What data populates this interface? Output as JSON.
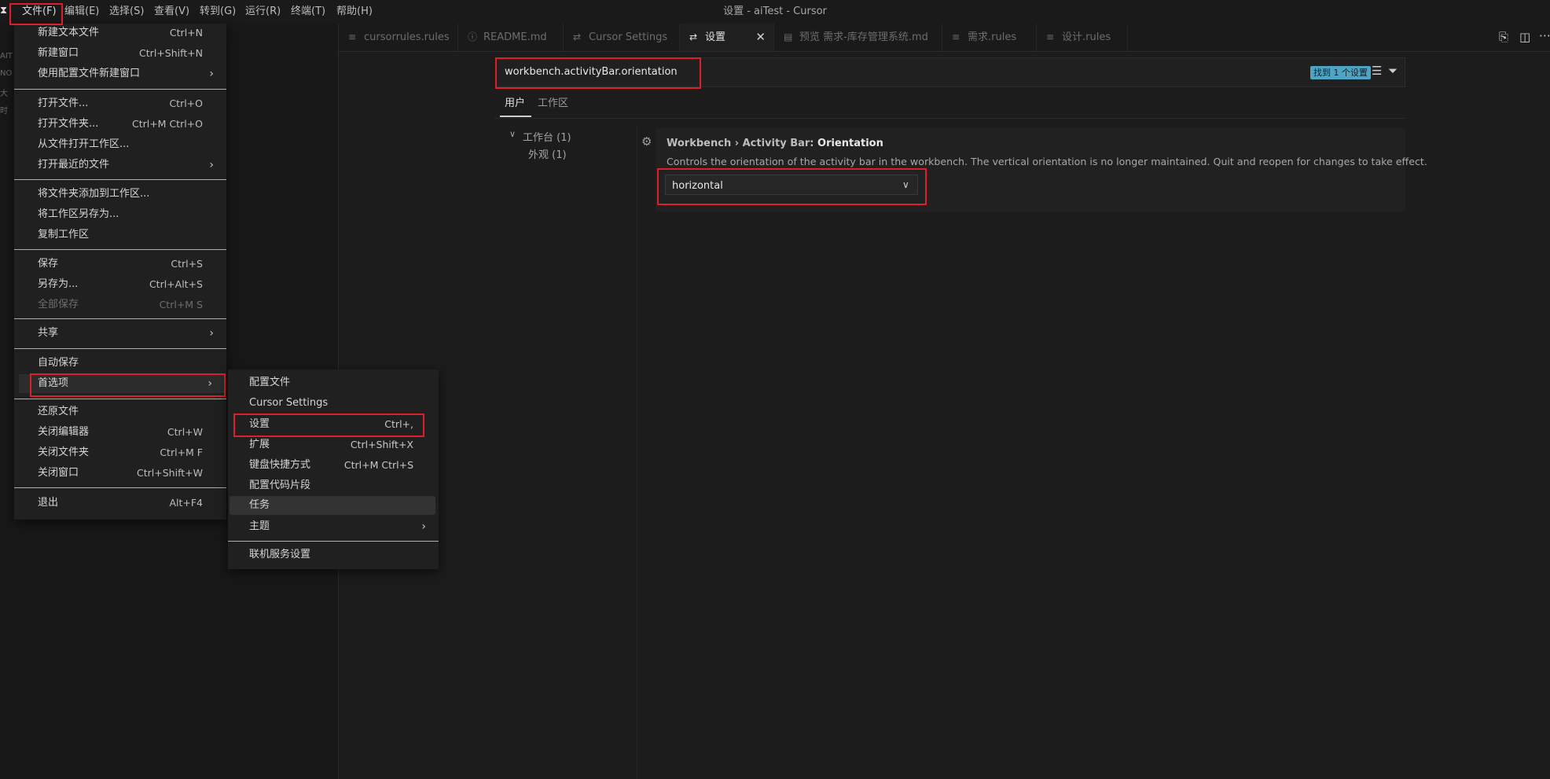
{
  "window": {
    "title": "设置 - aiTest - Cursor"
  },
  "menubar": [
    "文件(F)",
    "编辑(E)",
    "选择(S)",
    "查看(V)",
    "转到(G)",
    "运行(R)",
    "终端(T)",
    "帮助(H)"
  ],
  "explorer_bits": [
    "AIT",
    "NO",
    "大",
    "时"
  ],
  "tabs": [
    {
      "label": "cursorrules.rules",
      "icon": "≡"
    },
    {
      "label": "README.md",
      "icon": "ⓘ"
    },
    {
      "label": "Cursor Settings",
      "icon": "⇄"
    },
    {
      "label": "设置",
      "icon": "⇄"
    },
    {
      "label": "预览 需求-库存管理系统.md",
      "icon": "▤"
    },
    {
      "label": "需求.rules",
      "icon": "≡"
    },
    {
      "label": "设计.rules",
      "icon": "≡"
    }
  ],
  "settings": {
    "search_value": "workbench.activityBar.orientation",
    "found_badge": "找到 1 个设置",
    "tab_user": "用户",
    "tab_workspace": "工作区",
    "toc_workbench": "工作台 (1)",
    "toc_appearance": "外观 (1)",
    "setting_title_prefix": "Workbench › Activity Bar: ",
    "setting_title_key": "Orientation",
    "setting_desc": "Controls the orientation of the activity bar in the workbench. The vertical orientation is no longer maintained. Quit and reopen for changes to take effect.",
    "dropdown_value": "horizontal"
  },
  "file_menu": {
    "items": [
      {
        "label": "新建文本文件",
        "shortcut": "Ctrl+N"
      },
      {
        "label": "新建窗口",
        "shortcut": "Ctrl+Shift+N"
      },
      {
        "label": "使用配置文件新建窗口",
        "shortcut": ""
      },
      {
        "label": "打开文件...",
        "shortcut": "Ctrl+O"
      },
      {
        "label": "打开文件夹...",
        "shortcut": "Ctrl+M Ctrl+O"
      },
      {
        "label": "从文件打开工作区...",
        "shortcut": ""
      },
      {
        "label": "打开最近的文件",
        "shortcut": ""
      },
      {
        "label": "将文件夹添加到工作区...",
        "shortcut": ""
      },
      {
        "label": "将工作区另存为...",
        "shortcut": ""
      },
      {
        "label": "复制工作区",
        "shortcut": ""
      },
      {
        "label": "保存",
        "shortcut": "Ctrl+S"
      },
      {
        "label": "另存为...",
        "shortcut": "Ctrl+Alt+S"
      },
      {
        "label": "全部保存",
        "shortcut": "Ctrl+M S"
      },
      {
        "label": "共享",
        "shortcut": ""
      },
      {
        "label": "自动保存",
        "shortcut": ""
      },
      {
        "label": "首选项",
        "shortcut": ""
      },
      {
        "label": "还原文件",
        "shortcut": ""
      },
      {
        "label": "关闭编辑器",
        "shortcut": "Ctrl+W"
      },
      {
        "label": "关闭文件夹",
        "shortcut": "Ctrl+M F"
      },
      {
        "label": "关闭窗口",
        "shortcut": "Ctrl+Shift+W"
      },
      {
        "label": "退出",
        "shortcut": "Alt+F4"
      }
    ]
  },
  "pref_menu": {
    "items": [
      {
        "label": "配置文件",
        "shortcut": ""
      },
      {
        "label": "Cursor Settings",
        "shortcut": ""
      },
      {
        "label": "设置",
        "shortcut": "Ctrl+,"
      },
      {
        "label": "扩展",
        "shortcut": "Ctrl+Shift+X"
      },
      {
        "label": "键盘快捷方式",
        "shortcut": "Ctrl+M Ctrl+S"
      },
      {
        "label": "配置代码片段",
        "shortcut": ""
      },
      {
        "label": "任务",
        "shortcut": ""
      },
      {
        "label": "主题",
        "shortcut": ""
      },
      {
        "label": "联机服务设置",
        "shortcut": ""
      }
    ]
  }
}
